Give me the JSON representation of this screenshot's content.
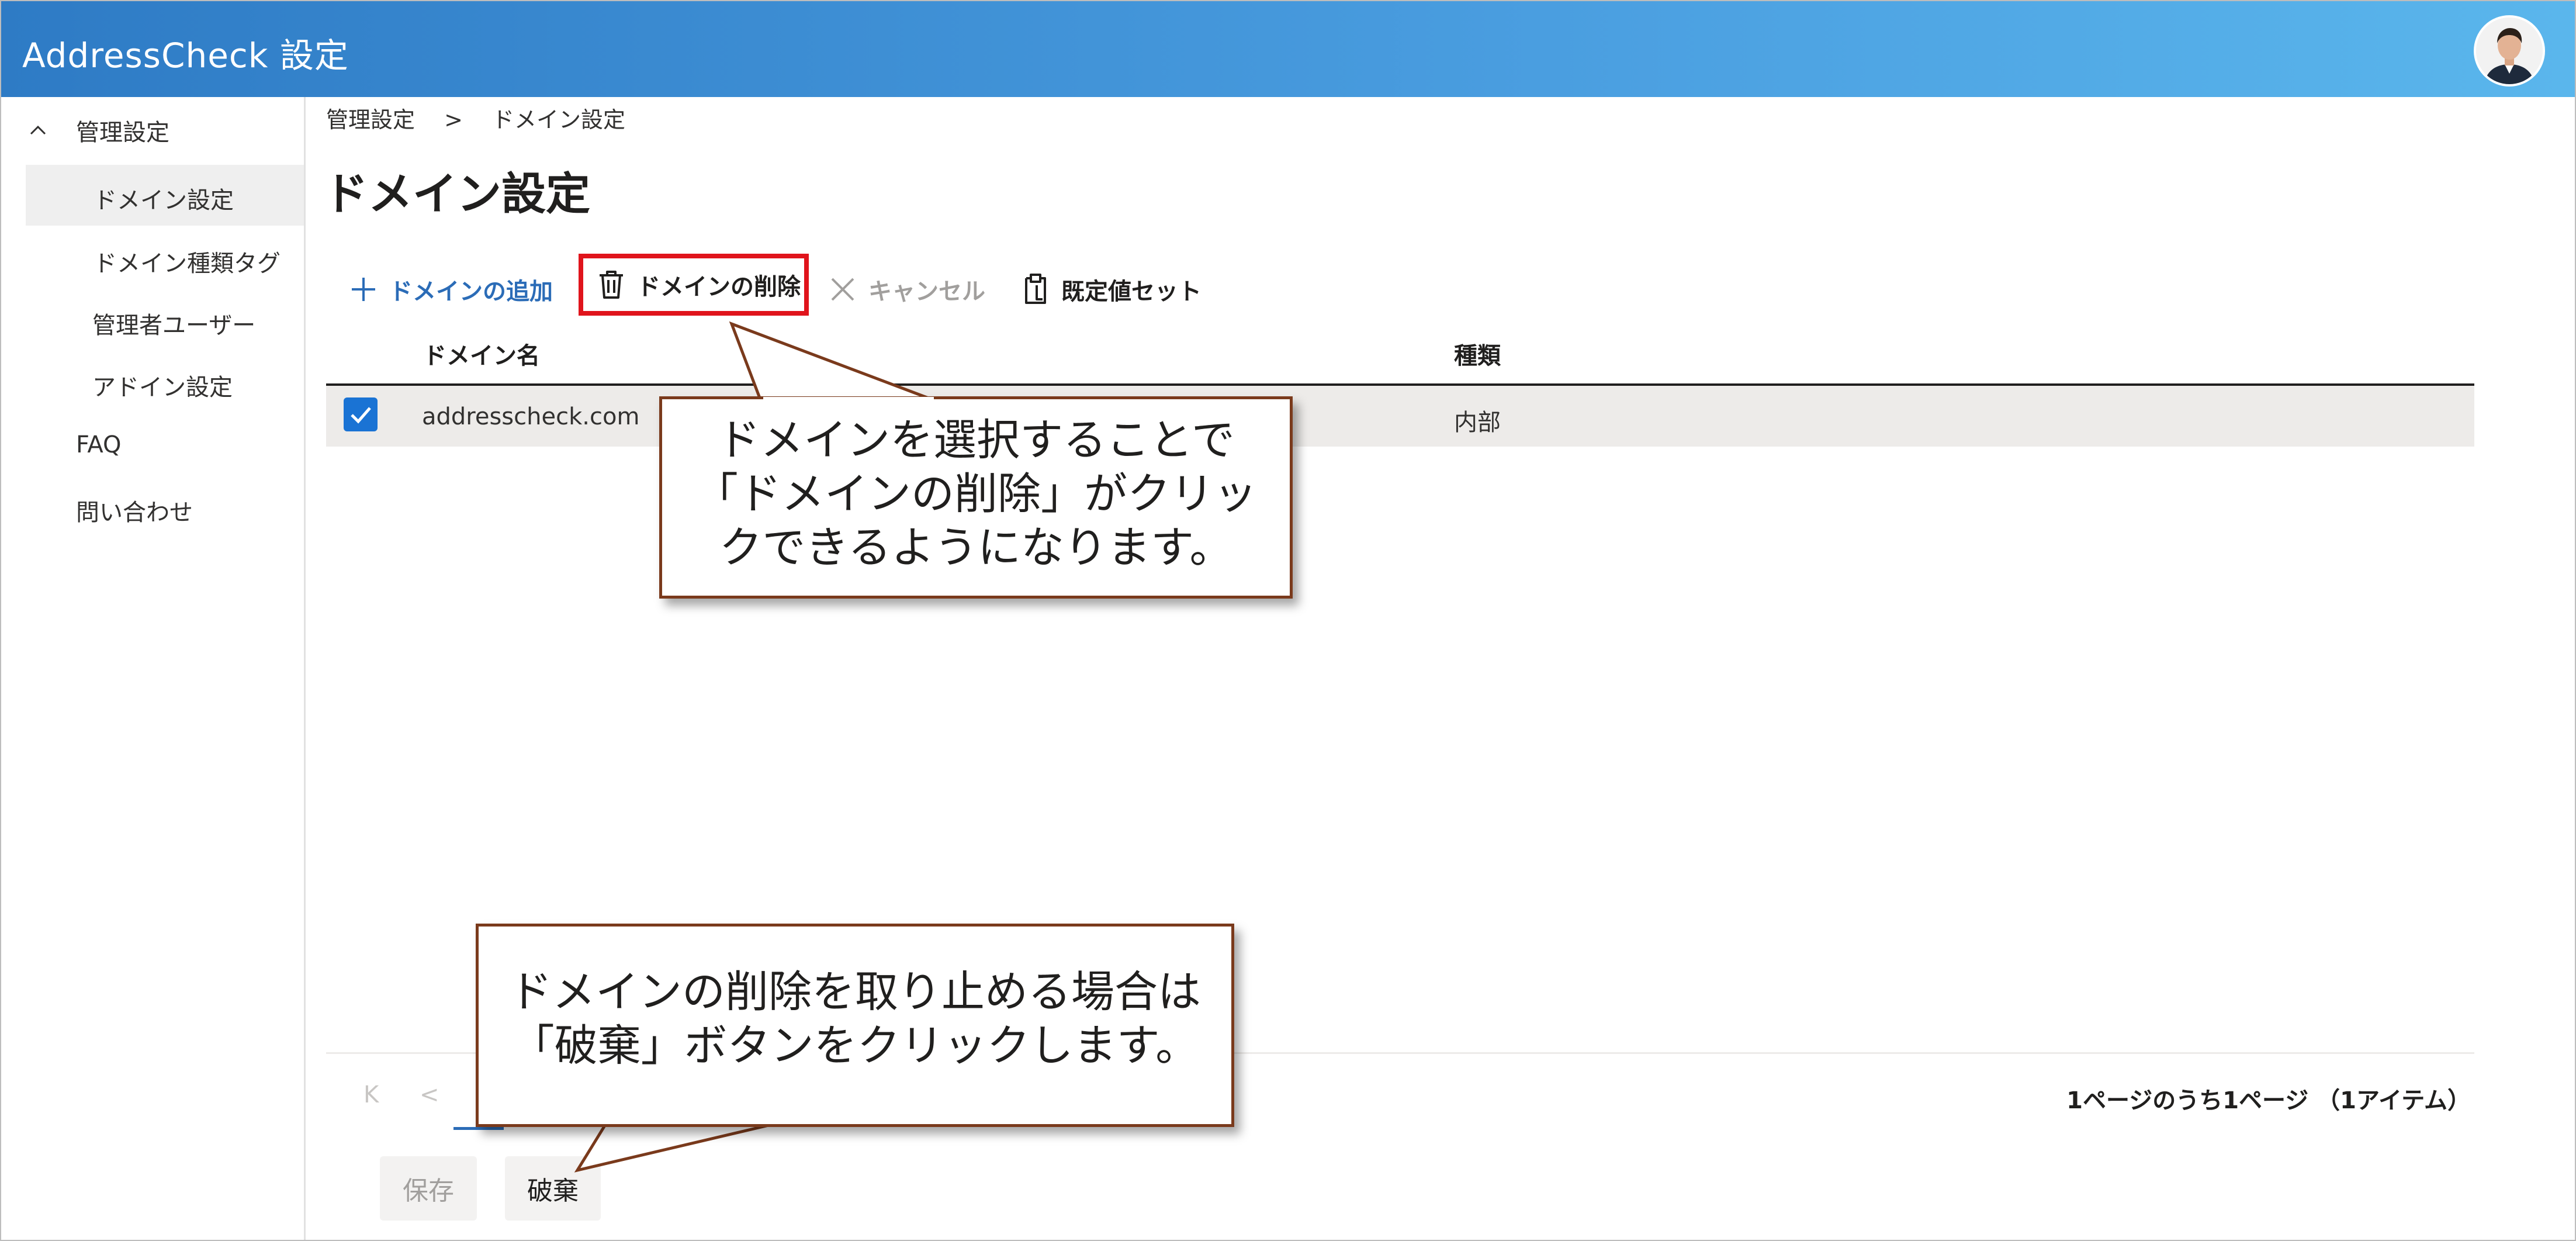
{
  "app": {
    "title": "AddressCheck 設定"
  },
  "sidebar": {
    "items": [
      {
        "label": "管理設定"
      },
      {
        "label": "ドメイン設定"
      },
      {
        "label": "ドメイン種類タグ"
      },
      {
        "label": "管理者ユーザー"
      },
      {
        "label": "アドイン設定"
      },
      {
        "label": "FAQ"
      },
      {
        "label": "問い合わせ"
      }
    ]
  },
  "breadcrumb": {
    "root": "管理設定",
    "separator": ">",
    "current": "ドメイン設定"
  },
  "page": {
    "title": "ドメイン設定"
  },
  "toolbar": {
    "add_label": "ドメインの追加",
    "delete_label": "ドメインの削除",
    "cancel_label": "キャンセル",
    "default_label": "既定値セット"
  },
  "table": {
    "columns": [
      "ドメイン名",
      "種類"
    ],
    "rows": [
      {
        "domain": "addresscheck.com",
        "type": "内部",
        "checked": true
      }
    ]
  },
  "pager": {
    "first": "K",
    "prev": "<",
    "summary": "1ページのうち1ページ （1アイテム）"
  },
  "buttons": {
    "save": "保存",
    "discard": "破棄"
  },
  "callouts": {
    "top": {
      "lines": [
        "ドメインを選択することで",
        "「ドメインの削除」がクリッ",
        "クできるようになります。"
      ]
    },
    "bottom": {
      "lines": [
        "ドメインの削除を取り止める場合は",
        "「破棄」ボタンをクリックします。"
      ]
    }
  },
  "colors": {
    "header_start": "#2e7bc5",
    "header_end": "#5ab6ec",
    "accent": "#2b6cb7",
    "highlight_border": "#e0141c",
    "callout_border": "#7a3a1c"
  }
}
